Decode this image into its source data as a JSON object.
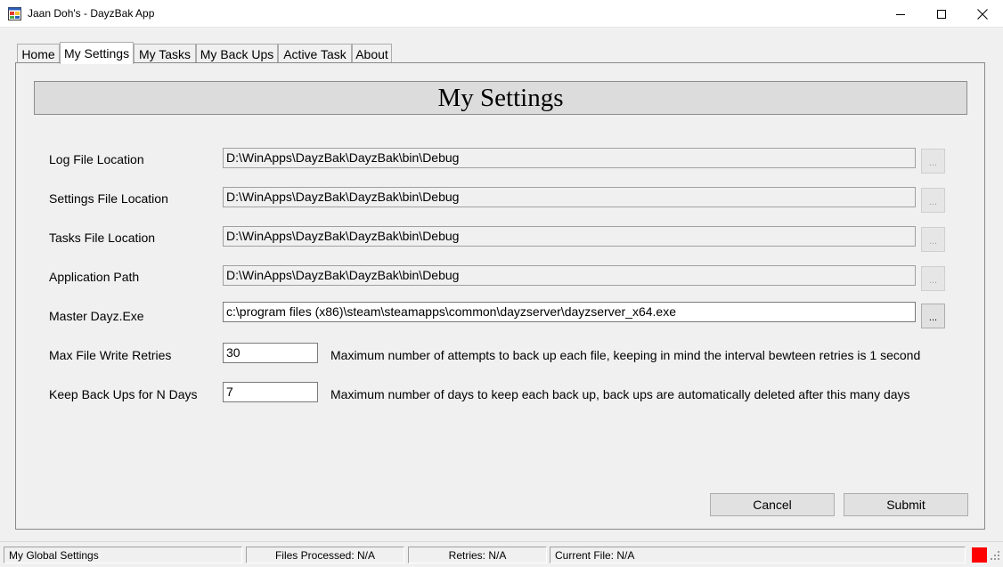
{
  "window": {
    "title": "Jaan Doh's - DayzBak App"
  },
  "tabs": [
    {
      "label": "Home"
    },
    {
      "label": "My Settings"
    },
    {
      "label": "My Tasks"
    },
    {
      "label": "My Back Ups"
    },
    {
      "label": "Active Task"
    },
    {
      "label": "About"
    }
  ],
  "page": {
    "title": "My Settings"
  },
  "settings": {
    "log_file": {
      "label": "Log File Location",
      "value": "D:\\WinApps\\DayzBak\\DayzBak\\bin\\Debug",
      "browse": "..."
    },
    "settings_file": {
      "label": "Settings File Location",
      "value": "D:\\WinApps\\DayzBak\\DayzBak\\bin\\Debug",
      "browse": "..."
    },
    "tasks_file": {
      "label": "Tasks File Location",
      "value": "D:\\WinApps\\DayzBak\\DayzBak\\bin\\Debug",
      "browse": "..."
    },
    "app_path": {
      "label": "Application Path",
      "value": "D:\\WinApps\\DayzBak\\DayzBak\\bin\\Debug",
      "browse": "..."
    },
    "master_exe": {
      "label": "Master Dayz.Exe",
      "value": "c:\\program files (x86)\\steam\\steamapps\\common\\dayzserver\\dayzserver_x64.exe",
      "browse": "..."
    },
    "max_retries": {
      "label": "Max File Write Retries",
      "value": "30",
      "hint": "Maximum number of attempts to back up each file, keeping in mind the interval bewteen retries is 1 second"
    },
    "keep_days": {
      "label": "Keep Back Ups for N Days",
      "value": "7",
      "hint": "Maximum number of days to keep each back up, back ups are automatically deleted after this many days"
    }
  },
  "buttons": {
    "cancel": "Cancel",
    "submit": "Submit"
  },
  "status": {
    "section": "My Global Settings",
    "files_processed": "Files Processed: N/A",
    "retries": "Retries: N/A",
    "current_file": "Current File: N/A",
    "indicator_color": "#ff0000"
  }
}
